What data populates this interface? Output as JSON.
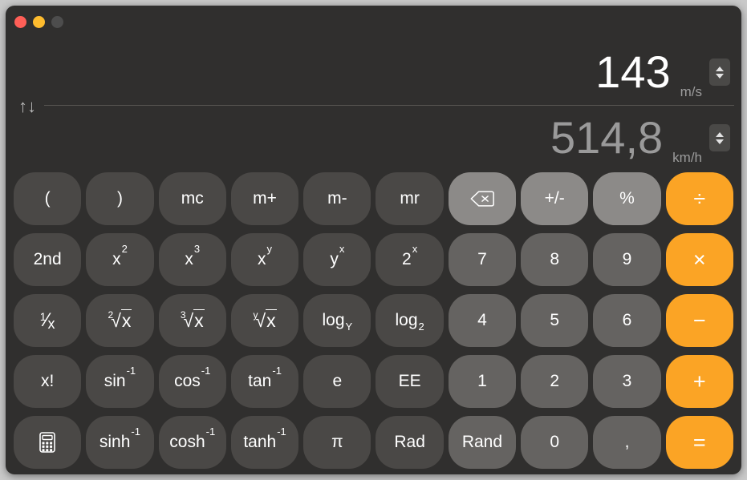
{
  "window": {
    "traffic_lights": [
      "close",
      "minimize",
      "zoom"
    ],
    "background_color": "#302f2e"
  },
  "display": {
    "swap_icon": "swap-vertical-arrows",
    "swap_glyph": "↑↓",
    "conversion": {
      "from": {
        "value": "143",
        "unit": "m/s",
        "stepper": "stepper-updown"
      },
      "to": {
        "value": "514,8",
        "unit": "km/h",
        "stepper": "stepper-updown"
      }
    }
  },
  "colors": {
    "function_key": "#4a4846",
    "utility_key": "#8c8a88",
    "digit_key": "#656361",
    "operator_key": "#fba425",
    "primary_text": "#ffffff",
    "secondary_text": "#9a9a9a"
  },
  "keypad": {
    "rows": [
      [
        {
          "label": "(",
          "type": "fn",
          "name": "paren-open"
        },
        {
          "label": ")",
          "type": "fn",
          "name": "paren-close"
        },
        {
          "label": "mc",
          "type": "fn",
          "name": "memory-clear"
        },
        {
          "label": "m+",
          "type": "fn",
          "name": "memory-add"
        },
        {
          "label": "m-",
          "type": "fn",
          "name": "memory-subtract"
        },
        {
          "label": "mr",
          "type": "fn",
          "name": "memory-recall"
        },
        {
          "label": "",
          "type": "util",
          "name": "delete-backspace",
          "icon": "delete-icon"
        },
        {
          "label": "+/-",
          "type": "util",
          "name": "sign-toggle"
        },
        {
          "label": "%",
          "type": "util",
          "name": "percent"
        },
        {
          "label": "÷",
          "type": "op",
          "name": "divide"
        }
      ],
      [
        {
          "label": "2nd",
          "type": "fn",
          "name": "second-function"
        },
        {
          "label": "x",
          "sup": "2",
          "type": "fn",
          "name": "x-squared"
        },
        {
          "label": "x",
          "sup": "3",
          "type": "fn",
          "name": "x-cubed"
        },
        {
          "label": "x",
          "sup": "y",
          "type": "fn",
          "name": "x-to-the-y"
        },
        {
          "label": "y",
          "sup": "x",
          "type": "fn",
          "name": "y-to-the-x"
        },
        {
          "label": "2",
          "sup": "x",
          "type": "fn",
          "name": "two-to-the-x"
        },
        {
          "label": "7",
          "type": "digit",
          "name": "digit-7"
        },
        {
          "label": "8",
          "type": "digit",
          "name": "digit-8"
        },
        {
          "label": "9",
          "type": "digit",
          "name": "digit-9"
        },
        {
          "label": "×",
          "type": "op",
          "name": "multiply"
        }
      ],
      [
        {
          "label": "1/x",
          "type": "fn",
          "name": "reciprocal",
          "render": "frac-1-x"
        },
        {
          "label": "2√x",
          "type": "fn",
          "name": "square-root",
          "render": "radical",
          "index": "2"
        },
        {
          "label": "3√x",
          "type": "fn",
          "name": "cube-root",
          "render": "radical",
          "index": "3"
        },
        {
          "label": "y√x",
          "type": "fn",
          "name": "y-root",
          "render": "radical",
          "index": "y"
        },
        {
          "label": "log",
          "sub": "Y",
          "type": "fn",
          "name": "log-base-y"
        },
        {
          "label": "log",
          "sub": "2",
          "type": "fn",
          "name": "log-base-2"
        },
        {
          "label": "4",
          "type": "digit",
          "name": "digit-4"
        },
        {
          "label": "5",
          "type": "digit",
          "name": "digit-5"
        },
        {
          "label": "6",
          "type": "digit",
          "name": "digit-6"
        },
        {
          "label": "−",
          "type": "op",
          "name": "subtract"
        }
      ],
      [
        {
          "label": "x!",
          "type": "fn",
          "name": "factorial"
        },
        {
          "label": "sin",
          "sup": "-1",
          "type": "fn",
          "name": "arcsine"
        },
        {
          "label": "cos",
          "sup": "-1",
          "type": "fn",
          "name": "arccosine"
        },
        {
          "label": "tan",
          "sup": "-1",
          "type": "fn",
          "name": "arctangent"
        },
        {
          "label": "e",
          "type": "fn",
          "name": "euler-constant"
        },
        {
          "label": "EE",
          "type": "fn",
          "name": "exponent-entry"
        },
        {
          "label": "1",
          "type": "digit",
          "name": "digit-1"
        },
        {
          "label": "2",
          "type": "digit",
          "name": "digit-2"
        },
        {
          "label": "3",
          "type": "digit",
          "name": "digit-3"
        },
        {
          "label": "+",
          "type": "op",
          "name": "add"
        }
      ],
      [
        {
          "label": "",
          "type": "fn",
          "name": "calculator-mode",
          "icon": "calculator-icon"
        },
        {
          "label": "sinh",
          "sup": "-1",
          "type": "fn",
          "name": "arc-hyperbolic-sine"
        },
        {
          "label": "cosh",
          "sup": "-1",
          "type": "fn",
          "name": "arc-hyperbolic-cosine"
        },
        {
          "label": "tanh",
          "sup": "-1",
          "type": "fn",
          "name": "arc-hyperbolic-tangent"
        },
        {
          "label": "π",
          "type": "fn",
          "name": "pi-constant"
        },
        {
          "label": "Rad",
          "type": "fn",
          "name": "radians-toggle"
        },
        {
          "label": "Rand",
          "type": "digit",
          "name": "random-number"
        },
        {
          "label": "0",
          "type": "digit",
          "name": "digit-0"
        },
        {
          "label": ",",
          "type": "digit",
          "name": "decimal-separator"
        },
        {
          "label": "=",
          "type": "op",
          "name": "equals"
        }
      ]
    ]
  }
}
